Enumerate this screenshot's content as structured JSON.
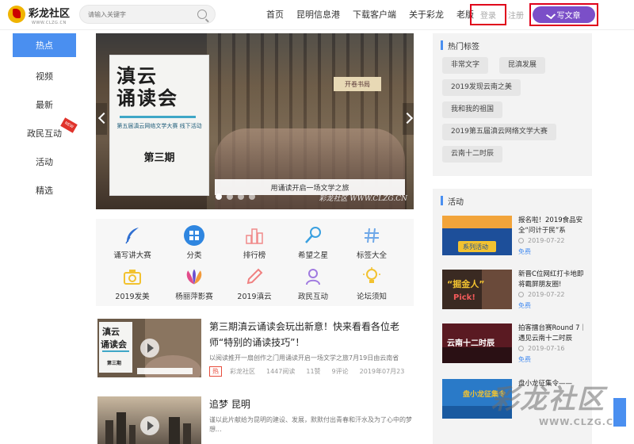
{
  "header": {
    "logo_text": "彩龙社区",
    "logo_sub": "WWW.CLZG.CN",
    "search_placeholder": "请输入关键字",
    "nav": [
      "首页",
      "昆明信息港",
      "下载客户端",
      "关于彩龙",
      "老版"
    ],
    "login": "登录",
    "register": "注册",
    "write": "写文章"
  },
  "sidebar": {
    "items": [
      {
        "label": "热点"
      },
      {
        "label": "视频"
      },
      {
        "label": "最新"
      },
      {
        "label": "政民互动",
        "badge": "NEW"
      },
      {
        "label": "活动"
      },
      {
        "label": "精选"
      }
    ]
  },
  "banner": {
    "title_line1": "滇云",
    "title_line2": "诵读会",
    "subtitle": "第五届滇云网络文学大赛 线下活动",
    "issue": "第三期",
    "caption": "用诵读开启一场文学之旅",
    "sign": "开卷书局",
    "watermark": "彩龙社区 WWW.CLZG.CN",
    "slides": 4,
    "active_slide": 1
  },
  "categories": [
    {
      "label": "诵写讲大赛",
      "icon": "feather-icon",
      "color": "#2f6fd1"
    },
    {
      "label": "分类",
      "icon": "grid-icon",
      "color": "#2f86e0"
    },
    {
      "label": "排行榜",
      "icon": "ranking-icon",
      "color": "#f08a8a"
    },
    {
      "label": "希望之星",
      "icon": "microphone-icon",
      "color": "#3aa0e0"
    },
    {
      "label": "标签大全",
      "icon": "hash-icon",
      "color": "#6fa8e8"
    },
    {
      "label": "2019发美",
      "icon": "camera-icon",
      "color": "#f2c230"
    },
    {
      "label": "杨丽萍影赛",
      "icon": "peacock-icon",
      "color": "#9a4fd0"
    },
    {
      "label": "2019滇云",
      "icon": "pencil-icon",
      "color": "#f08080"
    },
    {
      "label": "政民互动",
      "icon": "user-icon",
      "color": "#a07ae0"
    },
    {
      "label": "论坛须知",
      "icon": "lightbulb-icon",
      "color": "#f2c230"
    }
  ],
  "articles": [
    {
      "title": "第三期滇云诵读会玩出新意！快来看看各位老师“特别的诵读技巧”！",
      "desc": "以阅读推开一扇创作之门用诵读开启一场文学之旅7月19日由云南省",
      "hot": "热",
      "source": "彩龙社区",
      "reads": "1447阅读",
      "likes": "11赞",
      "comments": "9评论",
      "date": "2019年07月23"
    },
    {
      "title": "追梦 昆明",
      "desc": "谨以此片献给为昆明的建设、发展，默默付出青春和汗水及为了心中的梦想..."
    }
  ],
  "hot_tags": {
    "title": "热门标签",
    "tags": [
      "非常文字",
      "昆滇发展",
      "2019发现云南之美",
      "我和我的祖国",
      "2019第五届滇云网络文学大赛",
      "云南十二时辰"
    ]
  },
  "activities": {
    "title": "活动",
    "items": [
      {
        "title": "报名啦！2019食品安全“问计于民”系",
        "date": "2019-07-22",
        "price": "免费",
        "thumb_text": "系列活动"
      },
      {
        "title": "新晋C位网红打卡地即将霸屏朋友圈!",
        "date": "2019-07-22",
        "price": "免费",
        "thumb_text": "“掘金人”"
      },
      {
        "title": "拍客擂台赛Round 7｜遇见云南十二时辰",
        "date": "2019-07-16",
        "price": "免费",
        "thumb_text": "云南十二时辰"
      },
      {
        "title": "盘小龙征集令——",
        "date": "",
        "price": "",
        "thumb_text": "盘小龙征集令"
      }
    ]
  },
  "watermark": {
    "main": "彩龙社区",
    "sub": "WWW.CLZG.CN"
  }
}
